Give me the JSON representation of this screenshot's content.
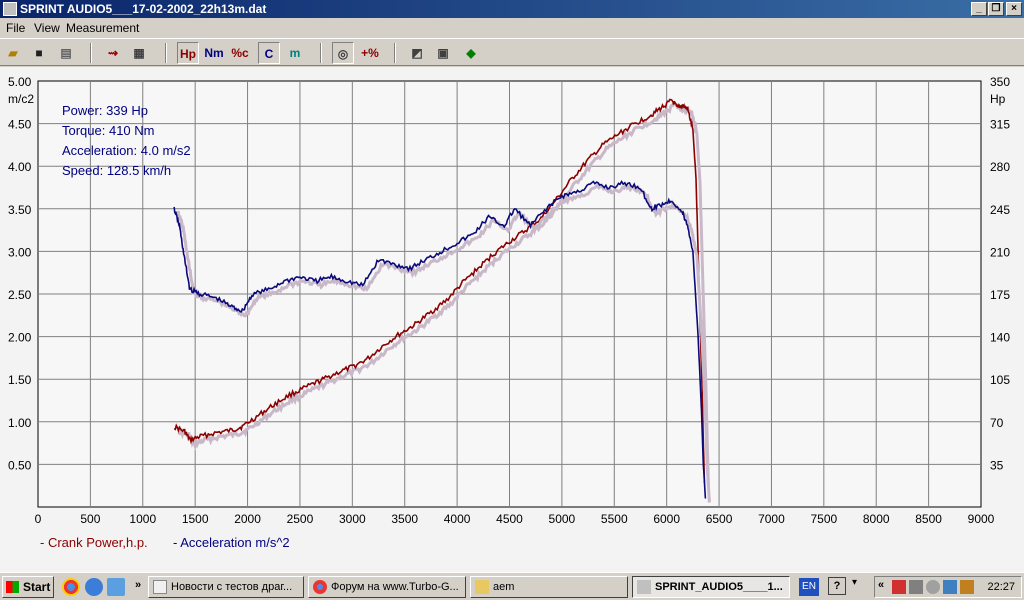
{
  "window": {
    "title": "SPRINT  AUDIO5___17-02-2002_22h13m.dat"
  },
  "menu": [
    "File",
    "View",
    "Measurement"
  ],
  "toolbar": {
    "hp_label": "Hp",
    "nm_label": "Nm",
    "pct_label": "%c",
    "c_label": "C",
    "m_label": "m",
    "plus_pct_label": "+%"
  },
  "readout": {
    "power": "Power: 339 Hp",
    "torque": "Torque: 410 Nm",
    "acceleration": "Acceleration: 4.0 m/s2",
    "speed": "Speed: 128.5 km/h"
  },
  "legend": {
    "crank_power": "- Crank Power,h.p.",
    "acceleration": "- Acceleration m/s^2"
  },
  "colors": {
    "power": "#8b0000",
    "acceleration": "#0a0a7a",
    "shadow": "#c8b8c8"
  },
  "chart_data": {
    "type": "line",
    "xlabel": "",
    "xlim": [
      0,
      9000
    ],
    "x_ticks": [
      "0",
      "500",
      "1000",
      "1500",
      "2000",
      "2500",
      "3000",
      "3500",
      "4000",
      "4500",
      "5000",
      "5500",
      "6000",
      "6500",
      "7000",
      "7500",
      "8000",
      "8500",
      "9000"
    ],
    "left_axis": {
      "unit": "m/c2",
      "ylim": [
        0,
        5.0
      ],
      "ticks": [
        "5.00",
        "4.50",
        "4.00",
        "3.50",
        "3.00",
        "2.50",
        "2.00",
        "1.50",
        "1.00",
        "0.50"
      ]
    },
    "right_axis": {
      "unit": "Hp",
      "ylim": [
        0,
        350
      ],
      "ticks": [
        "350",
        "315",
        "280",
        "245",
        "210",
        "175",
        "140",
        "105",
        "70",
        "35"
      ]
    },
    "grid": true,
    "series": [
      {
        "name": "Crank Power,h.p.",
        "axis": "right",
        "x": [
          1300,
          1400,
          1450,
          1550,
          1700,
          1850,
          1950,
          2100,
          2250,
          2400,
          2550,
          2700,
          2850,
          3000,
          3150,
          3300,
          3450,
          3600,
          3750,
          3900,
          4050,
          4200,
          4350,
          4500,
          4650,
          4800,
          4950,
          5100,
          5250,
          5400,
          5550,
          5700,
          5850,
          5950,
          6050,
          6100,
          6150,
          6200,
          6250,
          6280,
          6300,
          6320,
          6340,
          6360
        ],
        "values": [
          66,
          62,
          55,
          58,
          61,
          63,
          66,
          75,
          84,
          92,
          98,
          104,
          110,
          115,
          122,
          133,
          142,
          150,
          160,
          170,
          184,
          196,
          208,
          218,
          227,
          237,
          253,
          270,
          285,
          298,
          307,
          315,
          322,
          328,
          334,
          328,
          330,
          327,
          310,
          270,
          210,
          150,
          90,
          20
        ]
      },
      {
        "name": "Acceleration m/s^2",
        "axis": "left",
        "x": [
          1300,
          1350,
          1400,
          1450,
          1550,
          1700,
          1850,
          1950,
          2050,
          2200,
          2350,
          2500,
          2650,
          2800,
          2950,
          3100,
          3250,
          3400,
          3550,
          3700,
          3850,
          4000,
          4150,
          4300,
          4450,
          4550,
          4700,
          4850,
          5000,
          5150,
          5300,
          5450,
          5600,
          5750,
          5850,
          5950,
          6050,
          6150,
          6200,
          6250,
          6300,
          6330,
          6350,
          6370
        ],
        "values": [
          3.5,
          3.3,
          2.9,
          2.55,
          2.5,
          2.45,
          2.35,
          2.3,
          2.5,
          2.55,
          2.65,
          2.7,
          2.65,
          2.7,
          2.65,
          2.6,
          2.9,
          2.85,
          2.8,
          2.9,
          3.0,
          3.1,
          3.2,
          3.4,
          3.3,
          3.5,
          3.3,
          3.5,
          3.65,
          3.7,
          3.8,
          3.75,
          3.8,
          3.75,
          3.5,
          3.55,
          3.6,
          3.45,
          3.3,
          3.0,
          2.0,
          1.2,
          0.5,
          0.1
        ]
      }
    ]
  },
  "taskbar": {
    "start": "Start",
    "tasks": [
      "Новости с тестов драг...",
      "Форум на www.Turbo-G...",
      "aem",
      "SPRINT_AUDIO5____1..."
    ],
    "lang": "EN",
    "clock": "22:27"
  }
}
